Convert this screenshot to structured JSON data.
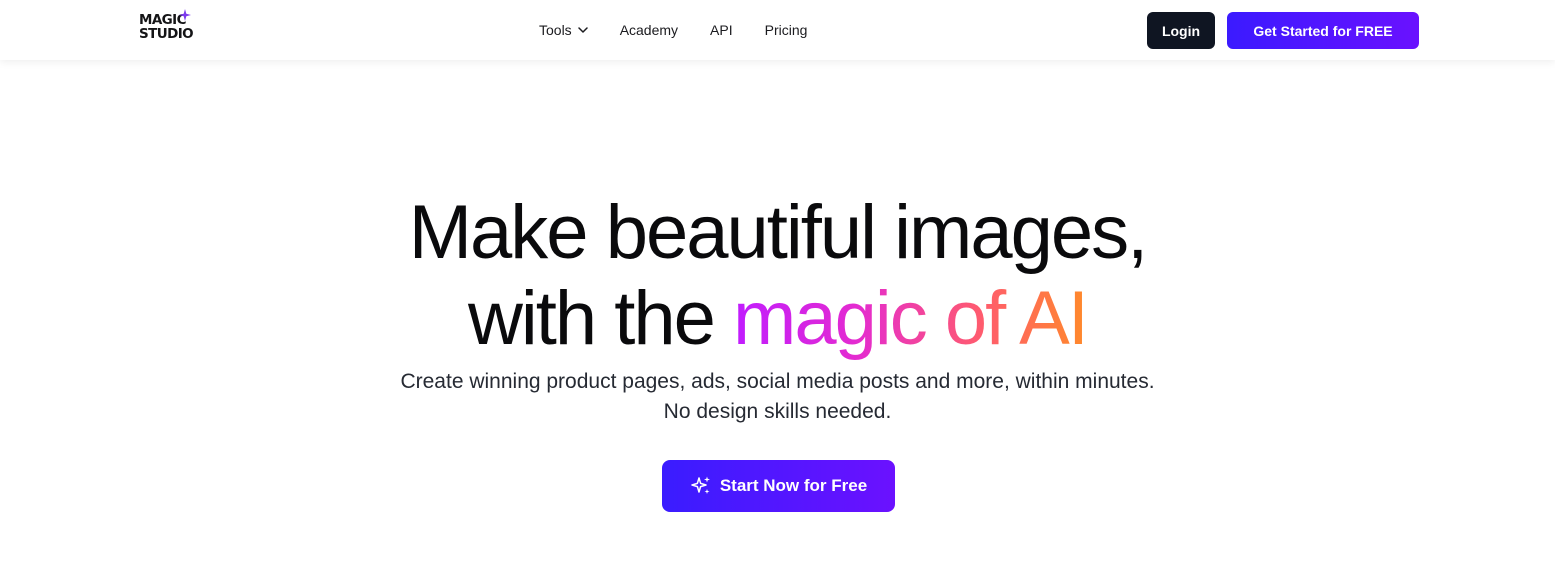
{
  "brand": {
    "logo_line1": "MAGIC",
    "logo_line2": "STUDIO",
    "accent": "#7c3aed"
  },
  "nav": {
    "links": [
      {
        "label": "Tools",
        "has_dropdown": true
      },
      {
        "label": "Academy"
      },
      {
        "label": "API"
      },
      {
        "label": "Pricing"
      }
    ],
    "login_label": "Login",
    "cta_label": "Get Started for FREE"
  },
  "hero": {
    "title_line1": "Make beautiful images,",
    "title_line2_plain": "with the ",
    "title_line2_highlight": "magic of AI",
    "subtitle_line1": "Create winning product pages, ads, social media posts and more, within minutes.",
    "subtitle_line2": "No design skills needed.",
    "cta_label": "Start Now for Free",
    "cta_icon": "sparkles-icon"
  },
  "colors": {
    "login_bg": "#0f1522",
    "cta_gradient_start": "#3b1aff",
    "cta_gradient_end": "#6a11ff",
    "highlight_gradient": [
      "#c01cff",
      "#e42bd0",
      "#ff5b6e",
      "#ff8a2a"
    ]
  }
}
